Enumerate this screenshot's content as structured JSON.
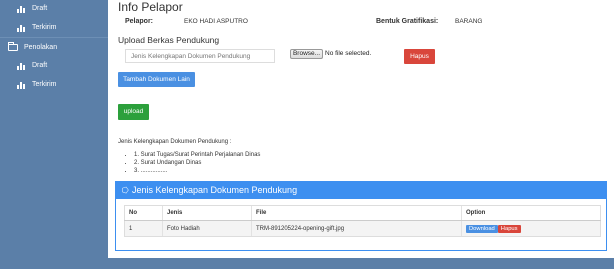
{
  "sidebar": {
    "items": [
      {
        "label": "Draft"
      },
      {
        "label": "Terkirim"
      },
      {
        "label": "Penolakan"
      },
      {
        "label": "Draft"
      },
      {
        "label": "Terkirim"
      }
    ]
  },
  "info": {
    "title": "Info Pelapor",
    "pelapor_label": "Pelapor:",
    "pelapor_value": "EKO HADI ASPUTRO",
    "gratifikasi_label": "Bentuk Gratifikasi:",
    "gratifikasi_value": "BARANG"
  },
  "upload_section": {
    "title": "Upload Berkas Pendukung",
    "input_placeholder": "Jenis Kelengkapan Dokumen Pendukung",
    "browse_label": "Browse...",
    "no_file_text": "No file selected.",
    "hapus_label": "Hapus",
    "tambah_label": "Tambah Dokumen Lain",
    "upload_label": "upload"
  },
  "jenis": {
    "title": "Jenis Kelengkapan Dokumen Pendukung :",
    "items": [
      "1. Surat Tugas/Surat Perintah Perjalanan Dinas",
      "2. Surat Undangan Dinas",
      "3. ................"
    ]
  },
  "panel": {
    "title": "Jenis Kelengkapan Dokumen Pendukung",
    "columns": [
      "No",
      "Jenis",
      "File",
      "Option"
    ],
    "rows": [
      {
        "no": "1",
        "jenis": "Foto Hadiah",
        "file": "TRM-891205224-opening-gift.jpg",
        "download_label": "Download",
        "hapus_label": "Hapus"
      }
    ]
  },
  "colors": {
    "sidebar": "#5b7fa8",
    "primary": "#4a90e2",
    "danger": "#d9463b",
    "success": "#2ca03c",
    "panel": "#3d8ff0"
  }
}
